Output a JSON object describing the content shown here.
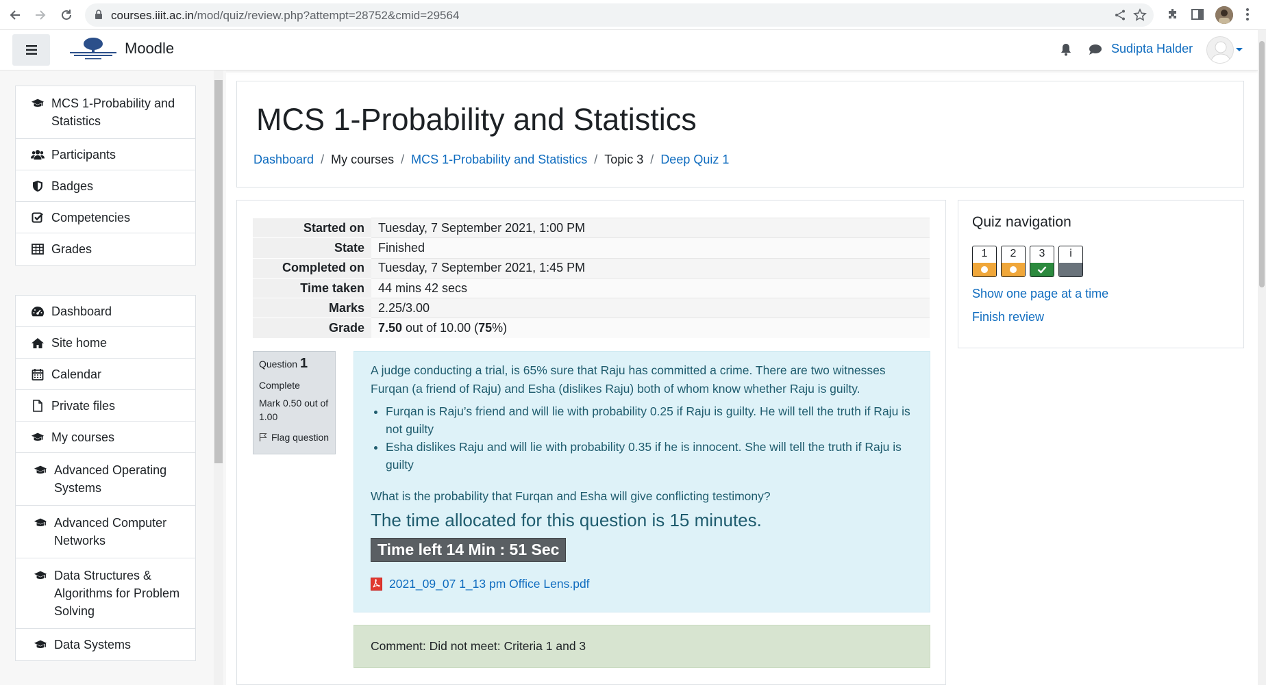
{
  "browser": {
    "url_host": "courses.iiit.ac.in",
    "url_path": "/mod/quiz/review.php?attempt=28752&cmid=29564"
  },
  "header": {
    "brand": "Moodle",
    "user_name": "Sudipta Halder"
  },
  "sidebar": {
    "course_items": [
      {
        "label": "MCS 1-Probability and Statistics",
        "icon": "graduation-cap-icon"
      },
      {
        "label": "Participants",
        "icon": "users-icon"
      },
      {
        "label": "Badges",
        "icon": "shield-icon"
      },
      {
        "label": "Competencies",
        "icon": "check-square-icon"
      },
      {
        "label": "Grades",
        "icon": "table-icon"
      }
    ],
    "site_items": [
      {
        "label": "Dashboard",
        "icon": "dashboard-icon"
      },
      {
        "label": "Site home",
        "icon": "home-icon"
      },
      {
        "label": "Calendar",
        "icon": "calendar-icon"
      },
      {
        "label": "Private files",
        "icon": "file-icon"
      },
      {
        "label": "My courses",
        "icon": "graduation-cap-icon"
      },
      {
        "label": "Advanced Operating Systems",
        "icon": "graduation-cap-icon"
      },
      {
        "label": "Advanced Computer Networks",
        "icon": "graduation-cap-icon"
      },
      {
        "label": "Data Structures & Algorithms for Problem Solving",
        "icon": "graduation-cap-icon"
      },
      {
        "label": "Data Systems",
        "icon": "graduation-cap-icon"
      }
    ]
  },
  "page": {
    "title": "MCS 1-Probability and Statistics",
    "breadcrumbs": [
      {
        "label": "Dashboard",
        "link": true
      },
      {
        "label": "My courses",
        "link": false
      },
      {
        "label": "MCS 1-Probability and Statistics",
        "link": true
      },
      {
        "label": "Topic 3",
        "link": false
      },
      {
        "label": "Deep Quiz 1",
        "link": true
      }
    ]
  },
  "summary": {
    "rows": [
      {
        "label": "Started on",
        "value": "Tuesday, 7 September 2021, 1:00 PM"
      },
      {
        "label": "State",
        "value": "Finished"
      },
      {
        "label": "Completed on",
        "value": "Tuesday, 7 September 2021, 1:45 PM"
      },
      {
        "label": "Time taken",
        "value": "44 mins 42 secs"
      },
      {
        "label": "Marks",
        "value": "2.25/3.00"
      }
    ],
    "grade_label": "Grade",
    "grade_value": "7.50",
    "grade_mid": " out of 10.00 (",
    "grade_percent": "75",
    "grade_end": "%)"
  },
  "question": {
    "prefix": "Question",
    "number": "1",
    "state": "Complete",
    "mark": "Mark 0.50 out of 1.00",
    "flag_label": "Flag question",
    "intro": "A judge conducting a trial, is 65% sure that Raju has committed a crime. There are two witnesses Furqan (a friend of Raju) and Esha (dislikes Raju) both of whom know whether Raju is guilty.",
    "bullets": [
      "Furqan is Raju’s friend and will lie with probability 0.25 if Raju is guilty. He will tell the truth if Raju is not guilty",
      "Esha dislikes Raju and will lie with probability 0.35 if he is innocent. She will tell the truth if Raju is guilty"
    ],
    "ask": "What is the probability that Furqan and Esha will give conflicting testimony?",
    "allocated": "The time allocated for this question is 15 minutes.",
    "timer": "Time left 14 Min : 51 Sec",
    "attachment": "2021_09_07 1_13 pm Office Lens.pdf",
    "comment": "Comment: Did not meet: Criteria 1 and 3"
  },
  "quiz_nav": {
    "title": "Quiz navigation",
    "buttons": [
      {
        "label": "1",
        "status": "partial"
      },
      {
        "label": "2",
        "status": "partial"
      },
      {
        "label": "3",
        "status": "correct"
      },
      {
        "label": "i",
        "status": "info"
      }
    ],
    "show_one_page": "Show one page at a time",
    "finish_review": "Finish review"
  },
  "colors": {
    "link": "#0f6cbf",
    "partial": "#f0a73a",
    "correct": "#2c8a3e",
    "qtext_bg": "#def2f8",
    "comment_bg": "#d7e4d0"
  }
}
